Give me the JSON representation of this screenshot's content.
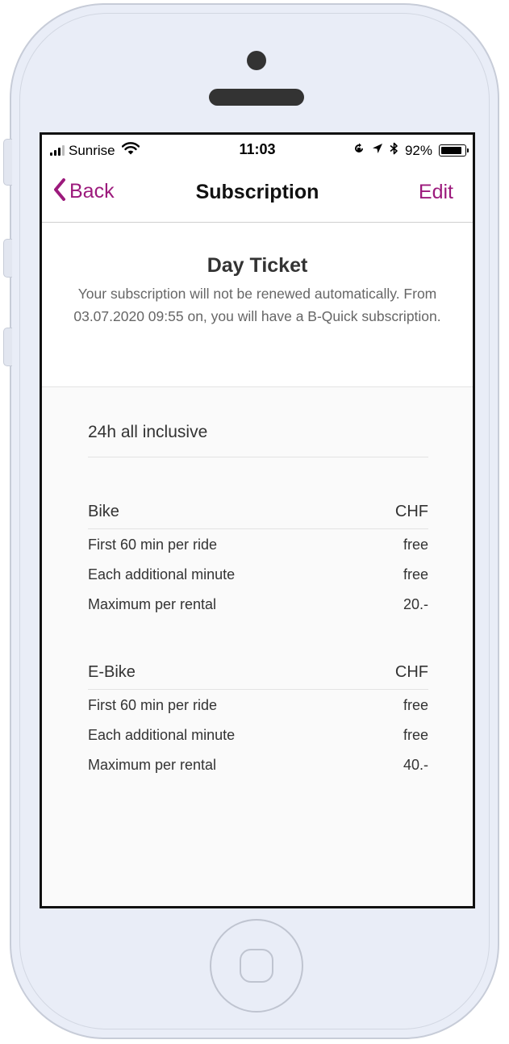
{
  "status_bar": {
    "carrier": "Sunrise",
    "time": "11:03",
    "battery_percent": "92%",
    "battery_level": 0.92,
    "icons": [
      "signal-icon",
      "wifi-icon",
      "orientation-lock-icon",
      "location-arrow-icon",
      "bluetooth-icon",
      "battery-icon"
    ]
  },
  "nav": {
    "back_label": "Back",
    "title": "Subscription",
    "edit_label": "Edit",
    "accent_color": "#9c1a7c"
  },
  "header": {
    "title": "Day Ticket",
    "description": "Your subscription will not be renewed automatically. From 03.07.2020 09:55 on, you will have a B-Quick subscription."
  },
  "plan": {
    "name": "24h all inclusive",
    "sections": [
      {
        "name": "Bike",
        "currency": "CHF",
        "rows": [
          {
            "label": "First 60 min per ride",
            "value": "free"
          },
          {
            "label": "Each additional minute",
            "value": "free"
          },
          {
            "label": "Maximum per rental",
            "value": "20.-"
          }
        ]
      },
      {
        "name": "E-Bike",
        "currency": "CHF",
        "rows": [
          {
            "label": "First 60 min per ride",
            "value": "free"
          },
          {
            "label": "Each additional minute",
            "value": "free"
          },
          {
            "label": "Maximum per rental",
            "value": "40.-"
          }
        ]
      }
    ]
  }
}
